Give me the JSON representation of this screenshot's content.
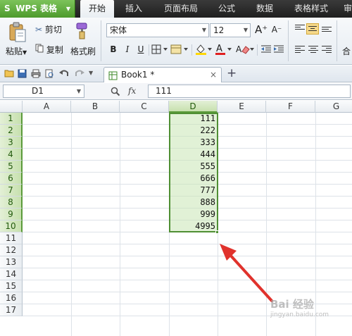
{
  "app": {
    "name": "WPS 表格",
    "logo": "S"
  },
  "menu": {
    "tabs": [
      {
        "label": "开始",
        "active": true
      },
      {
        "label": "插入",
        "active": false
      },
      {
        "label": "页面布局",
        "active": false
      },
      {
        "label": "公式",
        "active": false
      },
      {
        "label": "数据",
        "active": false
      },
      {
        "label": "表格样式",
        "active": false
      },
      {
        "label": "审",
        "active": false
      }
    ]
  },
  "ribbon": {
    "paste_label": "粘贴",
    "cut_label": "剪切",
    "copy_label": "复制",
    "format_painter_label": "格式刷",
    "font_name": "宋体",
    "font_size": "12",
    "bold": "B",
    "italic": "I",
    "underline": "U",
    "font_color_glyph": "A",
    "grow_font_glyph": "A⁺",
    "shrink_font_glyph": "A⁻",
    "merge_label": "合"
  },
  "tabstrip": {
    "document_tab": "Book1 *",
    "close_glyph": "×",
    "new_tab_glyph": "+"
  },
  "formula_bar": {
    "name_box": "D1",
    "fx_label": "fx",
    "value": "111"
  },
  "sheet": {
    "columns": [
      "A",
      "B",
      "C",
      "D",
      "E",
      "F",
      "G"
    ],
    "selected_column": "D",
    "rows": [
      "1",
      "2",
      "3",
      "4",
      "5",
      "6",
      "7",
      "8",
      "9",
      "10",
      "11",
      "12",
      "13",
      "14",
      "15",
      "16",
      "17"
    ],
    "selected_rows": [
      "1",
      "2",
      "3",
      "4",
      "5",
      "6",
      "7",
      "8",
      "9",
      "10"
    ],
    "column_d_values": [
      "111",
      "222",
      "333",
      "444",
      "555",
      "666",
      "777",
      "888",
      "999",
      "4995"
    ]
  },
  "watermark": {
    "text": "Bai 经验",
    "sub": "jingyan.baidu.com"
  },
  "colors": {
    "accent_green": "#4f8f33",
    "selection_fill": "#c8e6b4",
    "annotation_arrow": "#e0322c"
  }
}
